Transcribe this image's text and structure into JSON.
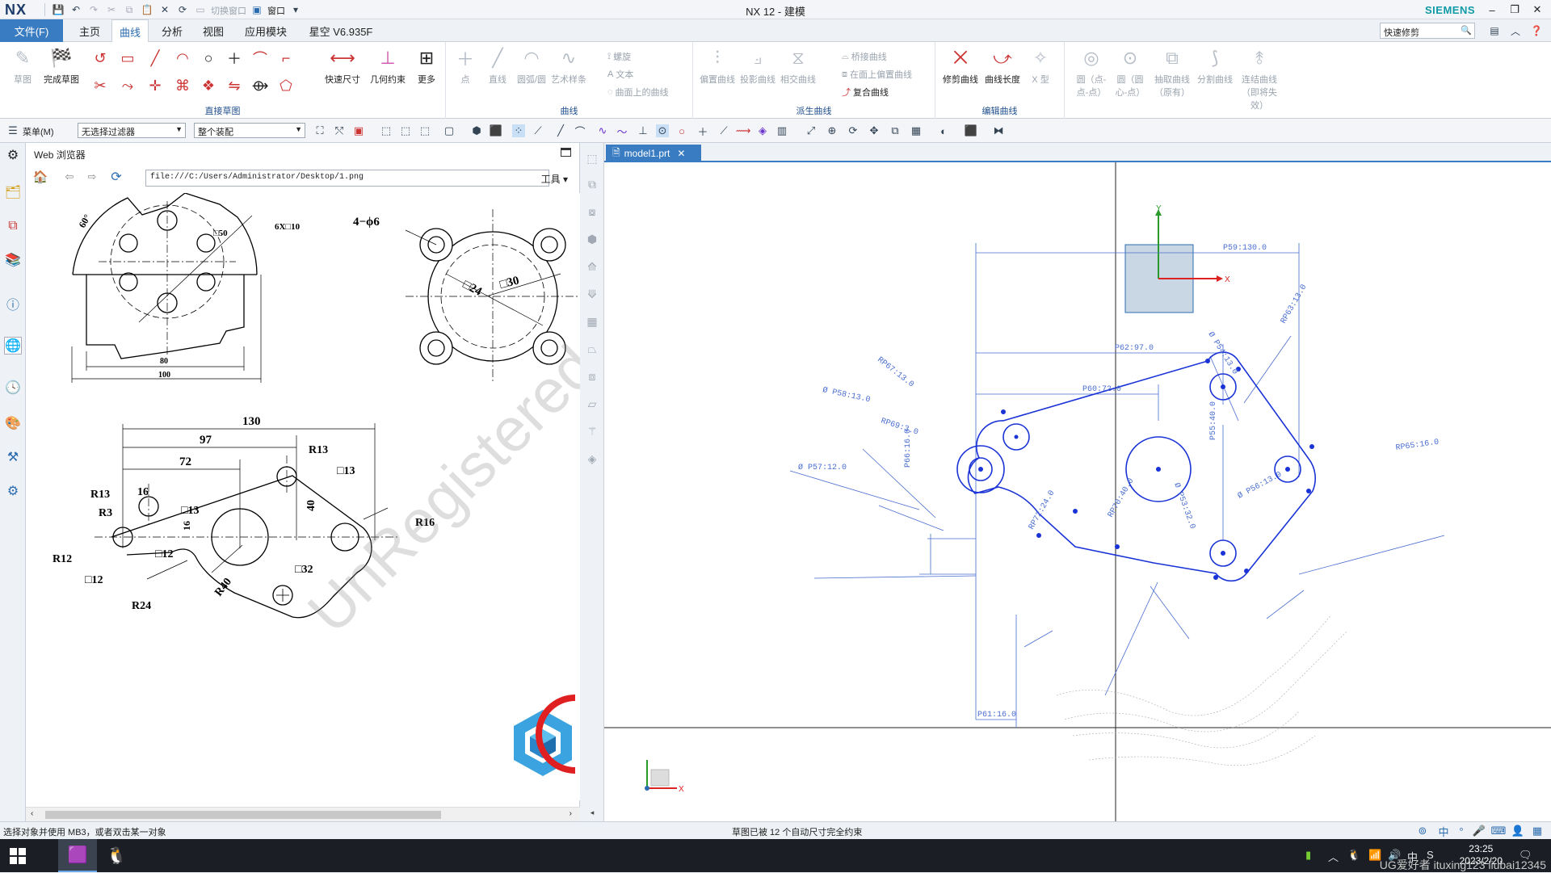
{
  "window": {
    "logo": "NX",
    "title": "NX 12 - 建模",
    "brand": "SIEMENS",
    "quick_access": {
      "switch_window": "切换窗口",
      "window_menu": "窗口"
    }
  },
  "tabs": {
    "file": "文件(F)",
    "items": [
      "主页",
      "曲线",
      "分析",
      "视图",
      "应用模块",
      "星空 V6.935F"
    ],
    "active": "曲线",
    "search_placeholder": "快速修剪"
  },
  "ribbon": {
    "sketch": {
      "label": "直接草图",
      "sketch_btn": "草图",
      "finish_btn": "完成草图",
      "quick_dim": "快速尺寸",
      "geo_constraint": "几何约束",
      "more": "更多"
    },
    "curve": {
      "label": "曲线",
      "point": "点",
      "line": "直线",
      "arc": "圆弧/圆",
      "art_spline": "艺术样条",
      "helix": "螺旋",
      "text": "文本",
      "curve_on_face": "曲面上的曲线"
    },
    "derived": {
      "label": "派生曲线",
      "offset": "偏置曲线",
      "project": "投影曲线",
      "intersect": "相交曲线",
      "bridge": "桥接曲线",
      "offset_on_face": "在面上偏置曲线",
      "composite": "复合曲线"
    },
    "edit": {
      "label": "编辑曲线",
      "trim": "修剪曲线",
      "curve_length": "曲线长度",
      "x_type": "X 型"
    },
    "extra": {
      "circle_3pt": "圆（点-点-点）",
      "circle_center": "圆（圆心-点）",
      "extract": "抽取曲线（原有）",
      "split": "分割曲线",
      "link": "连结曲线（即将失效）"
    }
  },
  "cmdbar": {
    "menu": "菜单(M)",
    "filter": "无选择过滤器",
    "scope": "整个装配"
  },
  "browser": {
    "title": "Web 浏览器",
    "url": "file:///C:/Users/Administrator/Desktop/1.png",
    "tools": "工具",
    "watermark": "UnRegistered",
    "drawing_labels": {
      "a60": "60°",
      "s50": "□50",
      "s6x10": "6X□10",
      "d80": "80",
      "d100": "100",
      "h4phi6": "4−ϕ6",
      "s24": "□24",
      "s30": "□30",
      "d130": "130",
      "d97": "97",
      "d72": "72",
      "r13a": "R13",
      "s13a": "□13",
      "r13b": "R13",
      "d16": "16",
      "r3": "R3",
      "s13b": "□13",
      "d40": "40",
      "r16": "R16",
      "d16v": "16",
      "r12": "R12",
      "s12a": "□12",
      "s12b": "□12",
      "s32": "□32",
      "r40": "R40",
      "r24": "R24"
    }
  },
  "model": {
    "tab": "model1.prt",
    "dims": {
      "p59": "P59:130.0",
      "p62": "P62:97.0",
      "p60": "P60:72.0",
      "rp63": "RP63:13.0",
      "p54": "Ø P54:13.0",
      "rp67": "RP67:13.0",
      "p58": "Ø P58:13.0",
      "rp69": "RP69:3.0",
      "p55": "P55:40.0",
      "p66": "P66:16.0",
      "p57": "Ø P57:12.0",
      "rp65": "RP65:16.0",
      "p56": "Ø P56:13.0",
      "rp72": "RP72:24.0",
      "rp70": "RP70:40.0",
      "p53": "Ø P53:32.0",
      "p61": "P61:16.0"
    },
    "axis_x": "X",
    "axis_y": "Y"
  },
  "status": {
    "left": "选择对象并使用 MB3，或者双击某一对象",
    "middle": "草图已被 12 个自动尺寸完全约束"
  },
  "taskbar": {
    "time": "23:25",
    "date": "2023/2/20",
    "overlay": "UG爱好者 ituxing123 liubai12345"
  },
  "colors": {
    "accent": "#3a7cc2",
    "sketch": "#1a33d6",
    "dim": "#4a6ed0",
    "brand": "#0f9aa7"
  }
}
